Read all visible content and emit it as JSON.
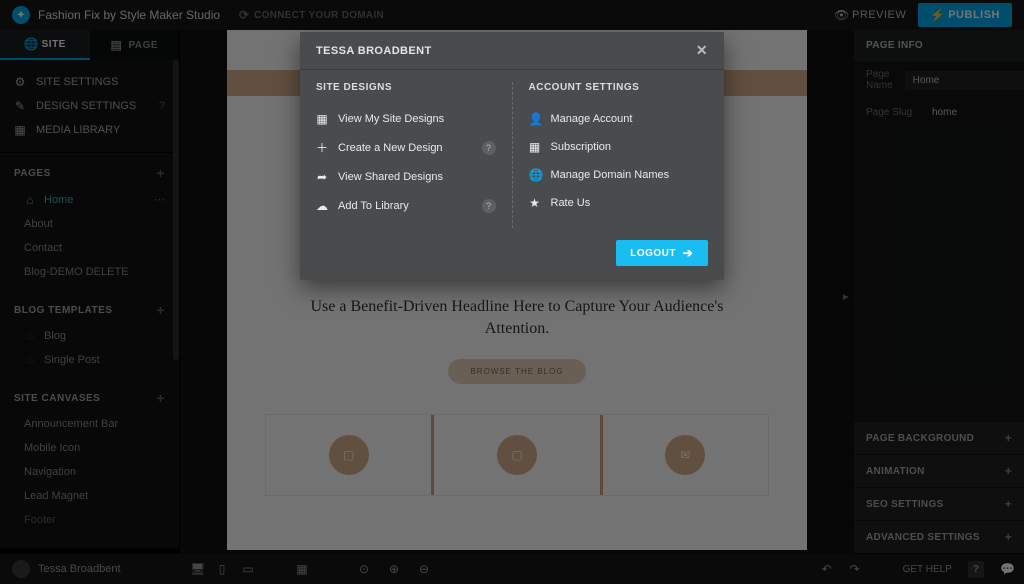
{
  "topbar": {
    "site_title": "Fashion Fix by Style Maker Studio",
    "connect": "CONNECT YOUR DOMAIN",
    "preview": "PREVIEW",
    "publish": "PUBLISH"
  },
  "tabs": {
    "site": "SITE",
    "page": "PAGE"
  },
  "side": {
    "settings": [
      "SITE SETTINGS",
      "DESIGN SETTINGS",
      "MEDIA LIBRARY"
    ],
    "icons": [
      "⚙",
      "✎",
      "▦"
    ],
    "pages_header": "PAGES",
    "pages": [
      "Home",
      "About",
      "Contact",
      "Blog-DEMO DELETE"
    ],
    "blog_header": "BLOG TEMPLATES",
    "blog_pages": [
      "Blog",
      "Single Post"
    ],
    "canvases_header": "SITE CANVASES",
    "canvases": [
      "Announcement Bar",
      "Mobile Icon",
      "Navigation",
      "Lead Magnet",
      "Footer"
    ]
  },
  "canvas": {
    "headline": "Use a Benefit-Driven Headline Here to Capture Your Audience's Attention.",
    "browse": "BROWSE THE BLOG"
  },
  "right": {
    "header": "PAGE INFO",
    "name_label": "Page Name",
    "name_value": "Home",
    "slug_label": "Page Slug",
    "slug_value": "home",
    "collapsers": [
      "PAGE BACKGROUND",
      "ANIMATION",
      "SEO SETTINGS",
      "ADVANCED SETTINGS"
    ]
  },
  "user": {
    "name": "Tessa Broadbent"
  },
  "bottom": {
    "gethelp": "GET HELP"
  },
  "modal": {
    "title": "TESSA BROADBENT",
    "col1_title": "SITE DESIGNS",
    "col1": [
      {
        "icon": "▦",
        "label": "View My Site Designs",
        "help": false
      },
      {
        "icon": "＋",
        "label": "Create a New Design",
        "help": true
      },
      {
        "icon": "➦",
        "label": "View Shared Designs",
        "help": false
      },
      {
        "icon": "☁",
        "label": "Add To Library",
        "help": true
      }
    ],
    "col2_title": "ACCOUNT SETTINGS",
    "col2": [
      {
        "icon": "👤",
        "label": "Manage Account"
      },
      {
        "icon": "▦",
        "label": "Subscription"
      },
      {
        "icon": "🌐",
        "label": "Manage Domain Names"
      },
      {
        "icon": "★",
        "label": "Rate Us"
      }
    ],
    "logout": "LOGOUT"
  }
}
